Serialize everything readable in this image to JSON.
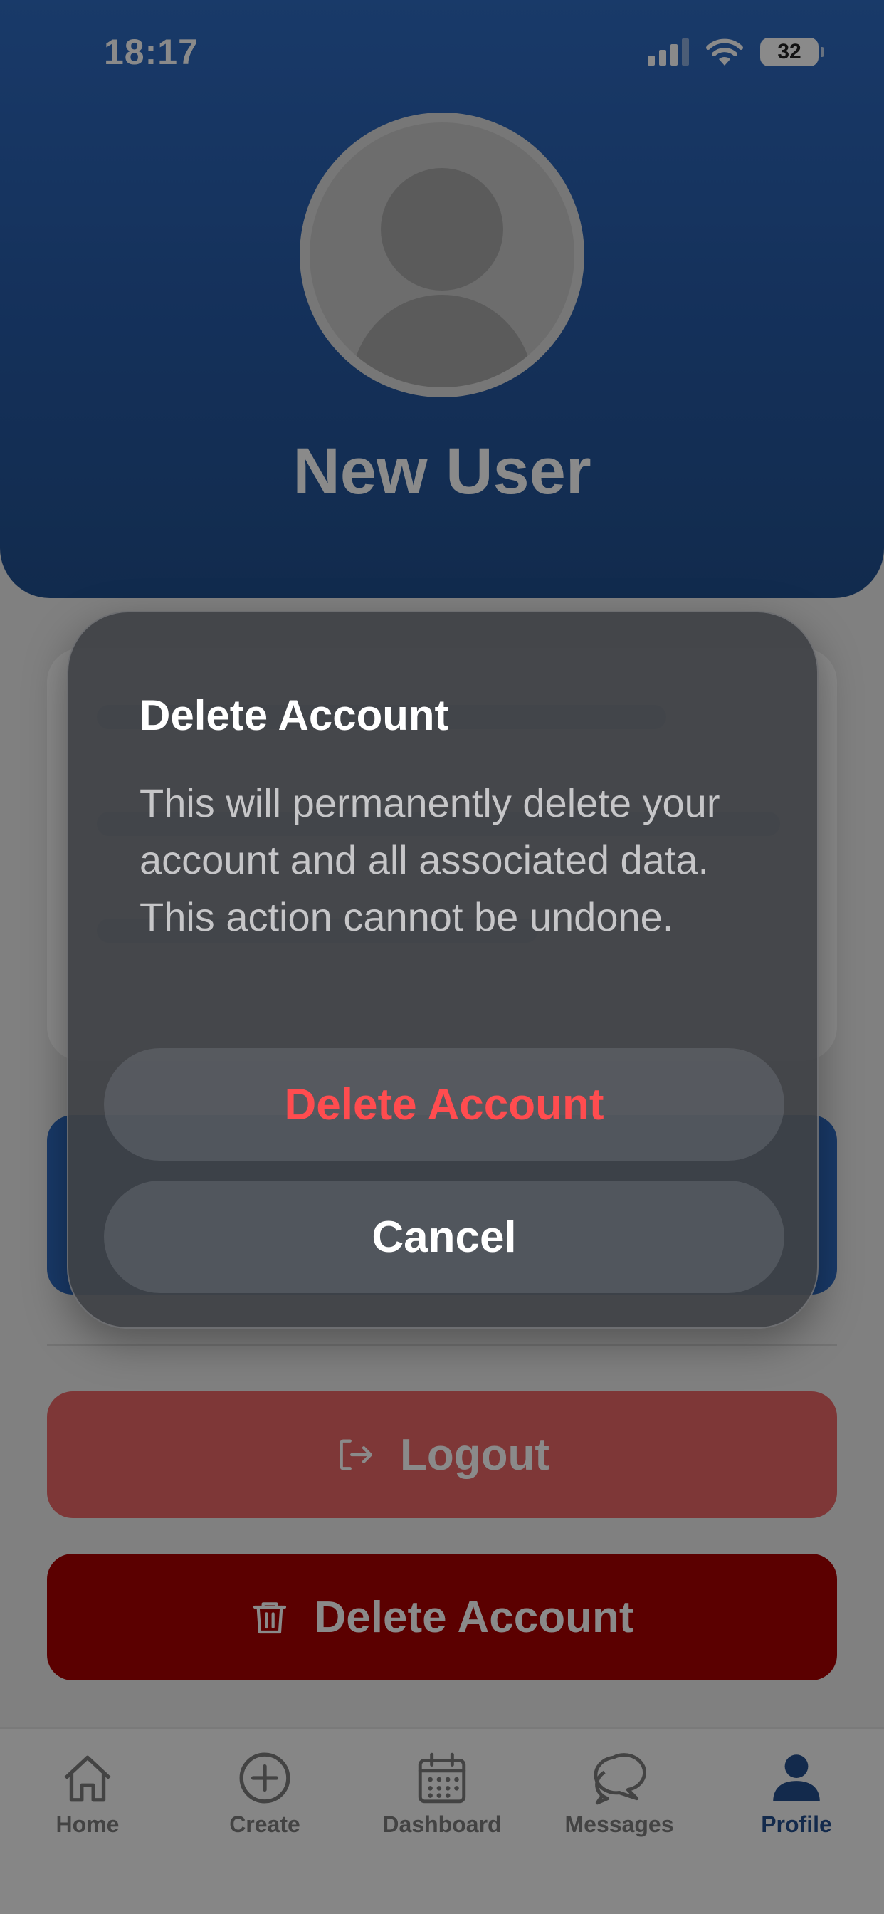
{
  "status_bar": {
    "time": "18:17",
    "battery": "32"
  },
  "profile": {
    "name": "New User"
  },
  "actions": {
    "logout_label": "Logout",
    "delete_label": "Delete Account"
  },
  "tabs": [
    {
      "label": "Home",
      "icon": "home-icon"
    },
    {
      "label": "Create",
      "icon": "plus-circle-icon"
    },
    {
      "label": "Dashboard",
      "icon": "calendar-icon"
    },
    {
      "label": "Messages",
      "icon": "chat-bubbles-icon"
    },
    {
      "label": "Profile",
      "icon": "person-icon",
      "active": true
    }
  ],
  "dialog": {
    "title": "Delete Account",
    "message": "This will permanently delete your account and all associated data. This action cannot be undone.",
    "confirm_label": "Delete Account",
    "cancel_label": "Cancel"
  },
  "colors": {
    "header": "#2f6bc2",
    "logout": "#e96767",
    "delete": "#a80000",
    "destructive_text": "#ff4c4f",
    "active_tab": "#234e8c"
  }
}
